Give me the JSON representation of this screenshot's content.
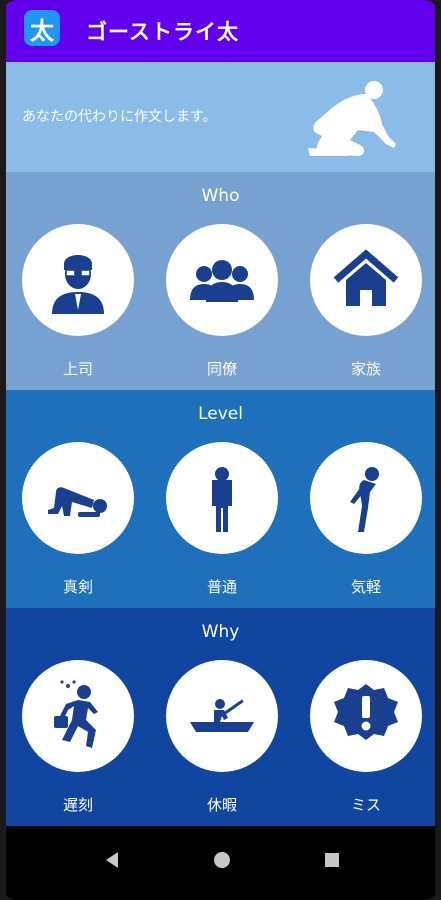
{
  "app": {
    "icon_glyph": "太",
    "title": "ゴーストライ太"
  },
  "banner": {
    "text": "あなたの代わりに作文します。",
    "illustration": "kneeling-writer-icon"
  },
  "sections": [
    {
      "title": "Who",
      "bg": "#76a1d0",
      "items": [
        {
          "label": "上司",
          "icon": "boss-icon"
        },
        {
          "label": "同僚",
          "icon": "colleagues-icon"
        },
        {
          "label": "家族",
          "icon": "house-icon"
        }
      ]
    },
    {
      "title": "Level",
      "bg": "#1e70ba",
      "items": [
        {
          "label": "真剣",
          "icon": "kneeling-bow-icon"
        },
        {
          "label": "普通",
          "icon": "standing-bow-icon"
        },
        {
          "label": "気軽",
          "icon": "casual-bow-icon"
        }
      ]
    },
    {
      "title": "Why",
      "bg": "#1046a0",
      "items": [
        {
          "label": "遅刻",
          "icon": "running-late-icon"
        },
        {
          "label": "休暇",
          "icon": "rowing-boat-icon"
        },
        {
          "label": "ミス",
          "icon": "alert-badge-icon"
        }
      ]
    }
  ],
  "colors": {
    "appbar": "#6200ee",
    "banner": "#8bbce8",
    "icon": "#1a3f8f"
  }
}
